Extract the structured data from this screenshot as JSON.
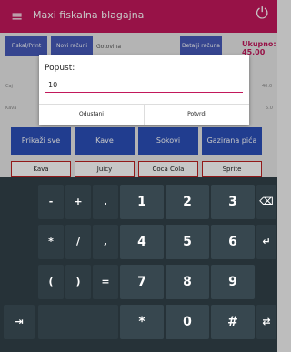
{
  "appbar": {
    "menu_glyph": "≡",
    "title": "Maxi fiskalna blagajna",
    "power_glyph": "⏻"
  },
  "top_buttons": [
    {
      "label": "Fiskal/Print"
    },
    {
      "label": "Novi računi"
    },
    {
      "label": "Gotovina"
    },
    {
      "label": "Detalji računa"
    }
  ],
  "ukupno": {
    "label": "Ukupno:",
    "value": "45.00"
  },
  "left_labels": [
    "Caj",
    "Kava"
  ],
  "right_values": [
    "40.0",
    "5.0"
  ],
  "categories": [
    "Prikaži sve",
    "Kave",
    "Sokovi",
    "Gazirana pića"
  ],
  "items": [
    "Kava",
    "Juicy",
    "Coca Cola",
    "Sprite"
  ],
  "dialog": {
    "title": "Popust:",
    "input_value": "10",
    "cancel_label": "Odustani",
    "confirm_label": "Potvrdi"
  },
  "keyboard": {
    "rows": [
      [
        "-",
        "+",
        ".",
        "1",
        "2",
        "3",
        "⌫"
      ],
      [
        "*",
        "/",
        ",",
        "4",
        "5",
        "6",
        "↵"
      ],
      [
        "(",
        ")",
        "=",
        "7",
        "8",
        "9"
      ],
      [
        "⇥",
        "",
        "*",
        "0",
        "#",
        "⇄"
      ]
    ]
  }
}
